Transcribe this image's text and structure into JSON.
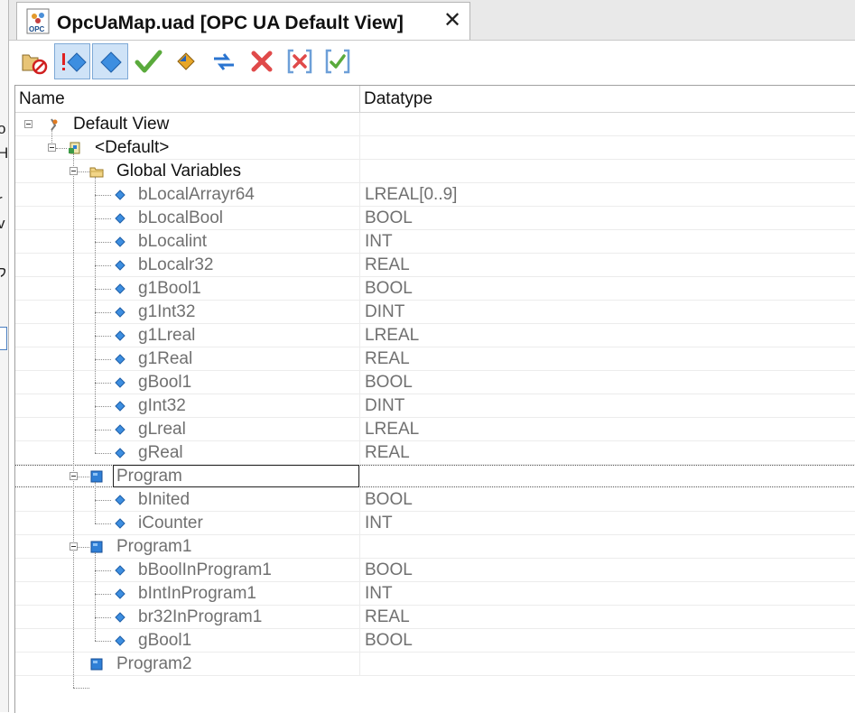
{
  "left_fragments": [
    "o",
    "H",
    "r",
    "v",
    "ק"
  ],
  "tab": {
    "title": "OpcUaMap.uad [OPC UA Default View]",
    "icon_label": "OPC",
    "close_glyph": "✕"
  },
  "toolbar": {
    "buttons": [
      {
        "name": "delete-disable-icon",
        "pressed": false
      },
      {
        "name": "mark-changed-icon",
        "pressed": true
      },
      {
        "name": "select-node-icon",
        "pressed": true
      },
      {
        "name": "check-icon",
        "pressed": false
      },
      {
        "name": "navigate-icon",
        "pressed": false
      },
      {
        "name": "sync-arrows-icon",
        "pressed": false
      },
      {
        "name": "delete-x-icon",
        "pressed": false
      },
      {
        "name": "bracket-x-icon",
        "pressed": false
      },
      {
        "name": "bracket-check-icon",
        "pressed": false
      }
    ]
  },
  "columns": {
    "name": "Name",
    "datatype": "Datatype"
  },
  "tree": [
    {
      "label": "Default View",
      "type": "",
      "level": 0,
      "icon": "view-icon",
      "dark": true
    },
    {
      "label": "<Default>",
      "type": "",
      "level": 1,
      "icon": "namespace-icon",
      "dark": true
    },
    {
      "label": "Global Variables",
      "type": "",
      "level": 2,
      "icon": "folder-icon",
      "dark": true
    },
    {
      "label": "bLocalArrayr64",
      "type": "LREAL[0..9]",
      "level": 3,
      "icon": "variable-icon"
    },
    {
      "label": "bLocalBool",
      "type": "BOOL",
      "level": 3,
      "icon": "variable-icon"
    },
    {
      "label": "bLocalint",
      "type": "INT",
      "level": 3,
      "icon": "variable-icon"
    },
    {
      "label": "bLocalr32",
      "type": "REAL",
      "level": 3,
      "icon": "variable-icon"
    },
    {
      "label": "g1Bool1",
      "type": "BOOL",
      "level": 3,
      "icon": "variable-icon"
    },
    {
      "label": "g1Int32",
      "type": "DINT",
      "level": 3,
      "icon": "variable-icon"
    },
    {
      "label": "g1Lreal",
      "type": "LREAL",
      "level": 3,
      "icon": "variable-icon"
    },
    {
      "label": "g1Real",
      "type": "REAL",
      "level": 3,
      "icon": "variable-icon"
    },
    {
      "label": "gBool1",
      "type": "BOOL",
      "level": 3,
      "icon": "variable-icon"
    },
    {
      "label": "gInt32",
      "type": "DINT",
      "level": 3,
      "icon": "variable-icon"
    },
    {
      "label": "gLreal",
      "type": "LREAL",
      "level": 3,
      "icon": "variable-icon"
    },
    {
      "label": "gReal",
      "type": "REAL",
      "level": 3,
      "icon": "variable-icon"
    },
    {
      "label": "Program",
      "type": "",
      "level": 2,
      "icon": "program-icon",
      "selected": true
    },
    {
      "label": "bInited",
      "type": "BOOL",
      "level": 3,
      "icon": "variable-icon"
    },
    {
      "label": "iCounter",
      "type": "INT",
      "level": 3,
      "icon": "variable-icon"
    },
    {
      "label": "Program1",
      "type": "",
      "level": 2,
      "icon": "program-icon"
    },
    {
      "label": "bBoolInProgram1",
      "type": "BOOL",
      "level": 3,
      "icon": "variable-icon"
    },
    {
      "label": "bIntInProgram1",
      "type": "INT",
      "level": 3,
      "icon": "variable-icon"
    },
    {
      "label": "br32InProgram1",
      "type": "REAL",
      "level": 3,
      "icon": "variable-icon"
    },
    {
      "label": "gBool1",
      "type": "BOOL",
      "level": 3,
      "icon": "variable-icon"
    },
    {
      "label": "Program2",
      "type": "",
      "level": 2,
      "icon": "program-icon"
    }
  ]
}
